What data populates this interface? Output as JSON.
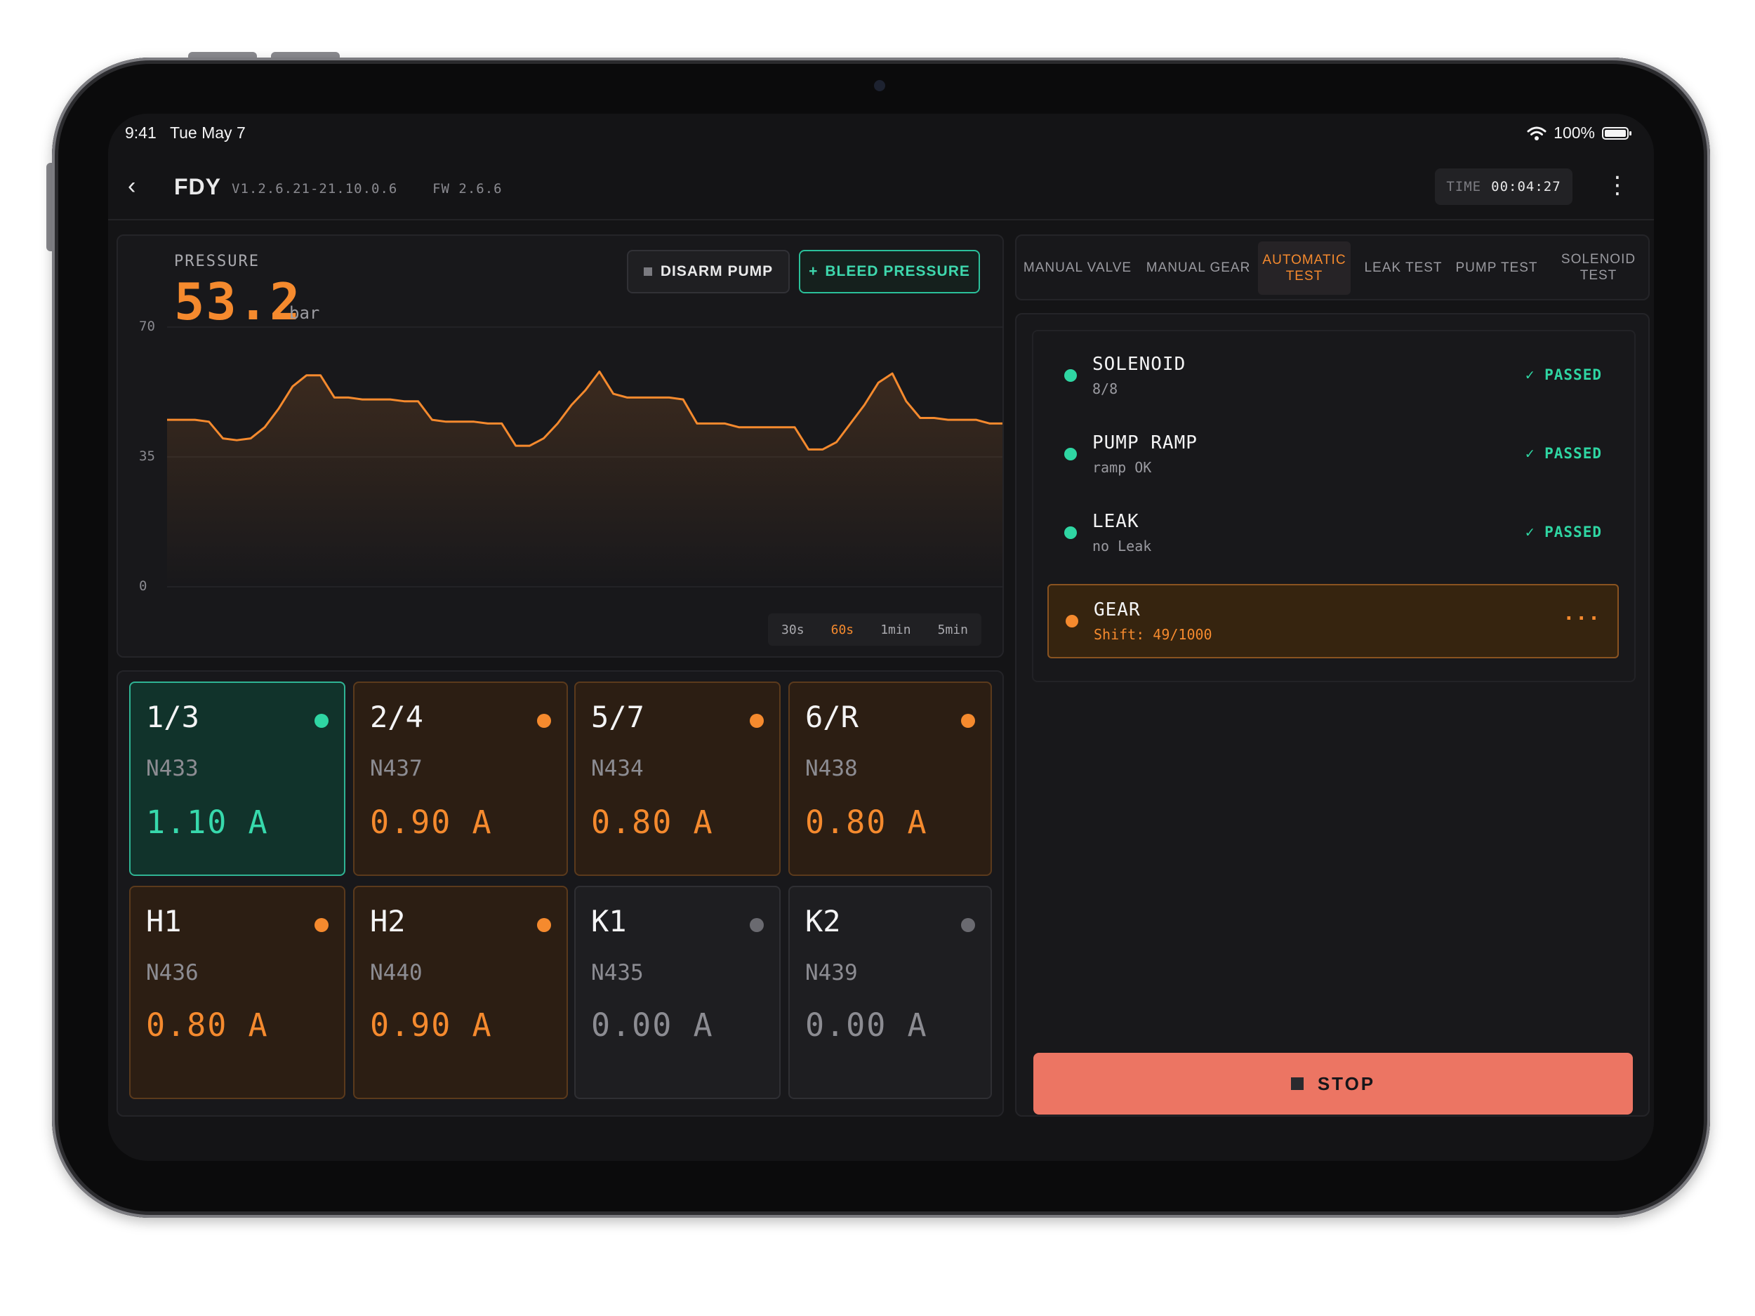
{
  "status_bar": {
    "time": "9:41",
    "date": "Tue May 7",
    "battery": "100%"
  },
  "header": {
    "back_icon": "‹",
    "title": "FDY",
    "version": "V1.2.6.21-21.10.0.6",
    "firmware": "FW 2.6.6",
    "time_label": "TIME",
    "time_value": "00:04:27",
    "menu_icon": "⋮"
  },
  "pressure": {
    "label": "PRESSURE",
    "value": "53.2",
    "unit": "bar",
    "disarm_label": "DISARM PUMP",
    "bleed_label": "BLEED PRESSURE",
    "bleed_icon": "+",
    "ranges": [
      "30s",
      "60s",
      "1min",
      "5min"
    ],
    "active_range": "60s"
  },
  "chart_data": {
    "type": "area",
    "ylim": [
      0,
      70
    ],
    "yticks": [
      "70",
      "35",
      "0"
    ],
    "x": [
      0,
      1,
      2,
      3,
      4,
      5,
      6,
      7,
      8,
      9,
      10,
      11,
      12,
      13,
      14,
      15,
      16,
      17,
      18,
      19,
      20,
      21,
      22,
      23,
      24,
      25,
      26,
      27,
      28,
      29,
      30,
      31,
      32,
      33,
      34,
      35,
      36,
      37,
      38,
      39,
      40,
      41,
      42,
      43,
      44,
      45,
      46,
      47,
      48,
      49,
      50,
      51,
      52,
      53,
      54,
      55,
      56,
      57,
      58,
      59,
      60
    ],
    "values": [
      45,
      45,
      45,
      44.5,
      40,
      39.5,
      40,
      43,
      48,
      54,
      57,
      57,
      51,
      51,
      50.5,
      50.5,
      50.5,
      50,
      50,
      45,
      44.5,
      44.5,
      44.5,
      44,
      44,
      38,
      38,
      40,
      44,
      49,
      53,
      58,
      52,
      51,
      51,
      51,
      51,
      50.5,
      44,
      44,
      44,
      43,
      43,
      43,
      43,
      43,
      37,
      37,
      39,
      44,
      49,
      55,
      57.5,
      50,
      45.5,
      45.5,
      45,
      45,
      45,
      44,
      44
    ],
    "series_color": "#f58a2e"
  },
  "gears": [
    {
      "name": "1/3",
      "code": "N433",
      "current": "1.10 A",
      "state": "teal"
    },
    {
      "name": "2/4",
      "code": "N437",
      "current": "0.90 A",
      "state": "orange"
    },
    {
      "name": "5/7",
      "code": "N434",
      "current": "0.80 A",
      "state": "orange"
    },
    {
      "name": "6/R",
      "code": "N438",
      "current": "0.80 A",
      "state": "orange"
    },
    {
      "name": "H1",
      "code": "N436",
      "current": "0.80 A",
      "state": "orange"
    },
    {
      "name": "H2",
      "code": "N440",
      "current": "0.90 A",
      "state": "orange"
    },
    {
      "name": "K1",
      "code": "N435",
      "current": "0.00 A",
      "state": "gray"
    },
    {
      "name": "K2",
      "code": "N439",
      "current": "0.00 A",
      "state": "gray"
    }
  ],
  "tabs": [
    {
      "label": "MANUAL VALVE"
    },
    {
      "label": "MANUAL GEAR"
    },
    {
      "label": "AUTOMATIC TEST",
      "line1": "AUTOMATIC",
      "line2": "TEST",
      "active": true
    },
    {
      "label": "LEAK TEST"
    },
    {
      "label": "PUMP TEST"
    },
    {
      "label": "SOLENOID TEST"
    }
  ],
  "tests": [
    {
      "name": "SOLENOID",
      "detail": "8/8",
      "status": "✓ PASSED"
    },
    {
      "name": "PUMP RAMP",
      "detail": "ramp OK",
      "status": "✓ PASSED"
    },
    {
      "name": "LEAK",
      "detail": "no Leak",
      "status": "✓ PASSED"
    },
    {
      "name": "GEAR",
      "detail": "Shift: 49/1000",
      "status": "···"
    }
  ],
  "stop_label": "STOP",
  "colors": {
    "accent": "#f58a2e",
    "ok": "#2fd6a3",
    "stop": "#ec7563",
    "background": "#141416"
  }
}
